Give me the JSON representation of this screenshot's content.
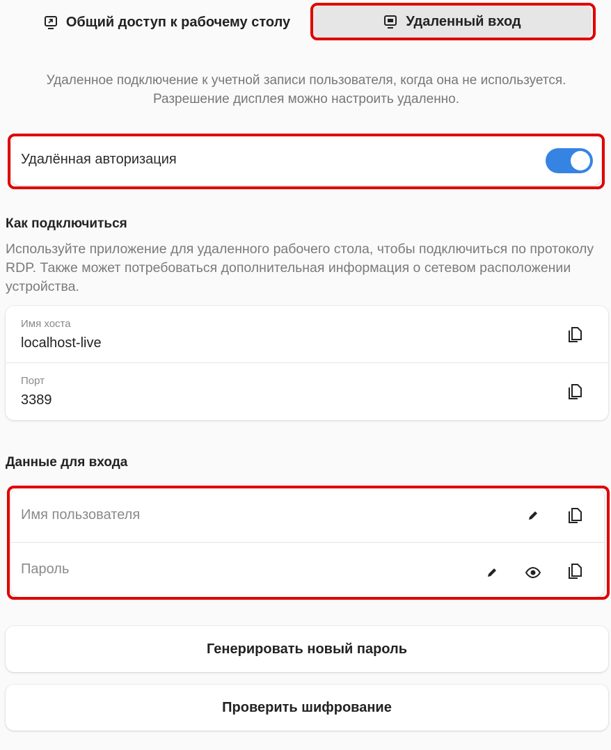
{
  "tabs": {
    "share_label": "Общий доступ к рабочему столу",
    "remote_label": "Удаленный вход"
  },
  "description": "Удаленное подключение к учетной записи пользователя, когда она не используется. Разрешение дисплея можно настроить удаленно.",
  "remote_login": {
    "label": "Удалённая авторизация",
    "enabled": true
  },
  "how_to_connect": {
    "title": "Как подключиться",
    "text": "Используйте приложение для удаленного рабочего стола, чтобы подключиться по протоколу RDP. Также может потребоваться дополнительная информация о сетевом расположении устройства.",
    "hostname_label": "Имя хоста",
    "hostname_value": "localhost-live",
    "port_label": "Порт",
    "port_value": "3389"
  },
  "credentials": {
    "title": "Данные для входа",
    "username_placeholder": "Имя пользователя",
    "password_placeholder": "Пароль"
  },
  "buttons": {
    "generate_password": "Генерировать новый пароль",
    "verify_encryption": "Проверить шифрование"
  },
  "colors": {
    "accent": "#3584e4",
    "highlight": "#e00000"
  },
  "icons": [
    "share-screen-icon",
    "remote-login-icon",
    "copy-icon",
    "edit-icon",
    "show-password-icon"
  ]
}
